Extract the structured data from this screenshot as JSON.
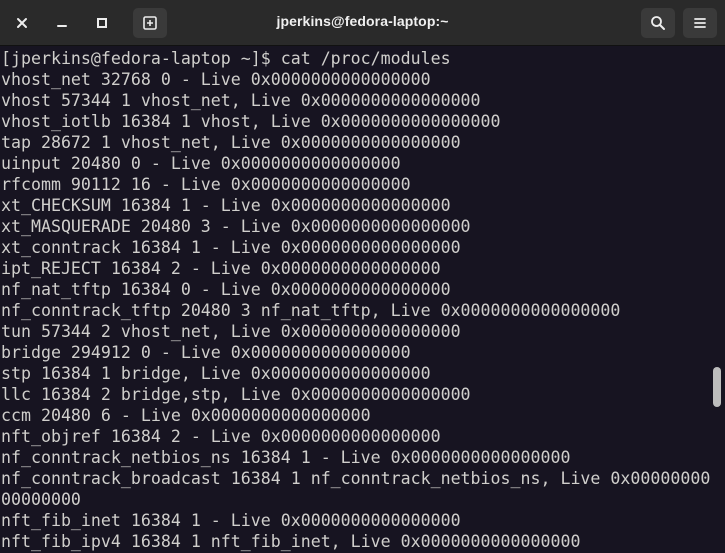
{
  "window": {
    "title": "jperkins@fedora-laptop:~"
  },
  "titlebar": {
    "close_glyph": "✕",
    "minimize_glyph": "–",
    "maximize_glyph": "□",
    "new_tab_glyph": "+",
    "search_icon": "search-icon",
    "menu_icon": "hamburger-menu-icon"
  },
  "terminal": {
    "lines": [
      "[jperkins@fedora-laptop ~]$ cat /proc/modules",
      "vhost_net 32768 0 - Live 0x0000000000000000",
      "vhost 57344 1 vhost_net, Live 0x0000000000000000",
      "vhost_iotlb 16384 1 vhost, Live 0x0000000000000000",
      "tap 28672 1 vhost_net, Live 0x0000000000000000",
      "uinput 20480 0 - Live 0x0000000000000000",
      "rfcomm 90112 16 - Live 0x0000000000000000",
      "xt_CHECKSUM 16384 1 - Live 0x0000000000000000",
      "xt_MASQUERADE 20480 3 - Live 0x0000000000000000",
      "xt_conntrack 16384 1 - Live 0x0000000000000000",
      "ipt_REJECT 16384 2 - Live 0x0000000000000000",
      "nf_nat_tftp 16384 0 - Live 0x0000000000000000",
      "nf_conntrack_tftp 20480 3 nf_nat_tftp, Live 0x0000000000000000",
      "tun 57344 2 vhost_net, Live 0x0000000000000000",
      "bridge 294912 0 - Live 0x0000000000000000",
      "stp 16384 1 bridge, Live 0x0000000000000000",
      "llc 16384 2 bridge,stp, Live 0x0000000000000000",
      "ccm 20480 6 - Live 0x0000000000000000",
      "nft_objref 16384 2 - Live 0x0000000000000000",
      "nf_conntrack_netbios_ns 16384 1 - Live 0x0000000000000000",
      "nf_conntrack_broadcast 16384 1 nf_conntrack_netbios_ns, Live 0x00000000",
      "00000000",
      "nft_fib_inet 16384 1 - Live 0x0000000000000000",
      "nft_fib_ipv4 16384 1 nft_fib_inet, Live 0x0000000000000000"
    ]
  },
  "colors": {
    "background": "#171421",
    "titlebar": "#2a2a2a",
    "text": "#d0cfcc"
  }
}
